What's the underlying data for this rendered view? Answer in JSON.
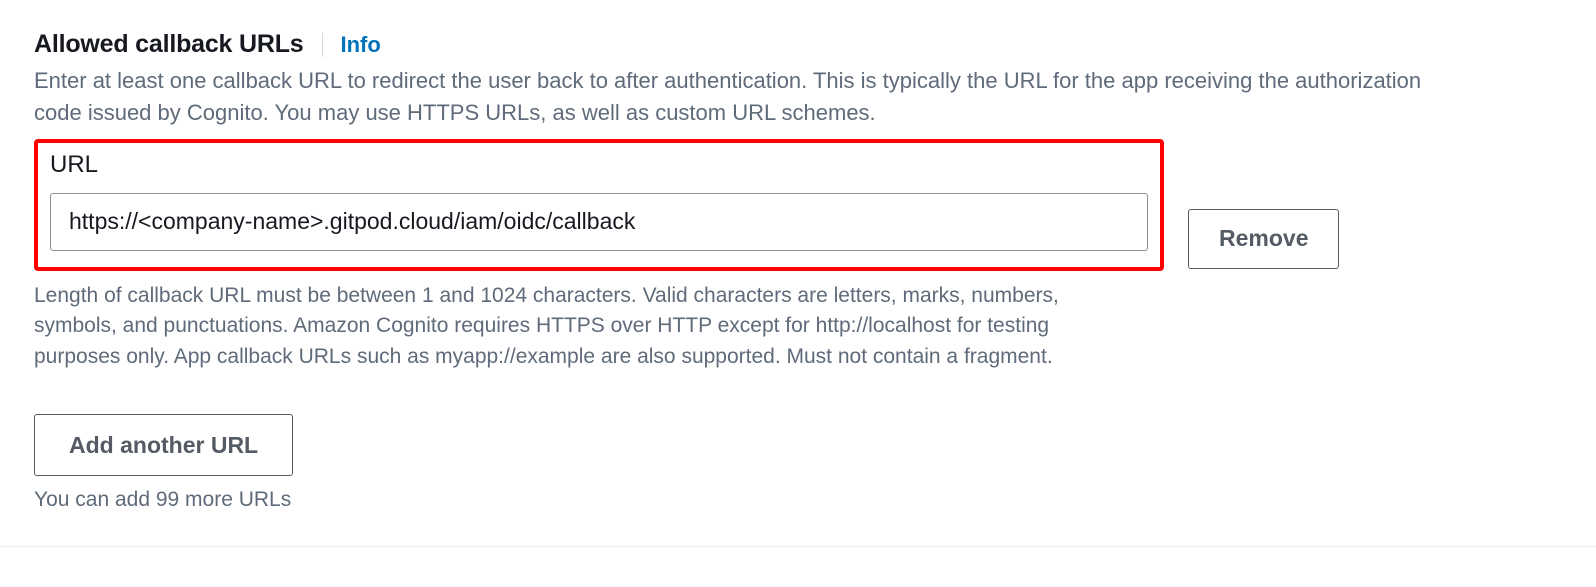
{
  "section": {
    "title": "Allowed callback URLs",
    "info_label": "Info",
    "description": "Enter at least one callback URL to redirect the user back to after authentication. This is typically the URL for the app receiving the authorization code issued by Cognito. You may use HTTPS URLs, as well as custom URL schemes."
  },
  "url_field": {
    "label": "URL",
    "value": "https://<company-name>.gitpod.cloud/iam/oidc/callback",
    "help_text": "Length of callback URL must be between 1 and 1024 characters. Valid characters are letters, marks, numbers, symbols, and punctuations. Amazon Cognito requires HTTPS over HTTP except for http://localhost for testing purposes only. App callback URLs such as myapp://example are also supported. Must not contain a fragment."
  },
  "buttons": {
    "remove": "Remove",
    "add_another": "Add another URL"
  },
  "limit_text": "You can add 99 more URLs"
}
